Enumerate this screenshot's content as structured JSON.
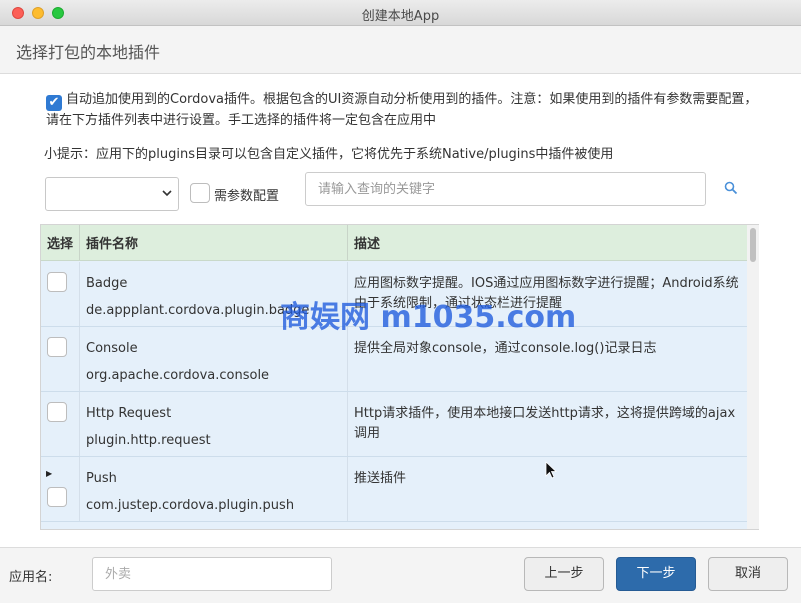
{
  "window": {
    "title": "创建本地App"
  },
  "header": {
    "title": "选择打包的本地插件"
  },
  "notice": {
    "checked": true,
    "text": "自动追加使用到的Cordova插件。根据包含的UI资源自动分析使用到的插件。注意：如果使用到的插件有参数需要配置，请在下方插件列表中进行设置。手工选择的插件将一定包含在应用中"
  },
  "hint": {
    "text": "小提示：应用下的plugins目录可以包含自定义插件，它将优先于系统Native/plugins中插件被使用"
  },
  "filter": {
    "selected": "",
    "param_label": "需参数配置",
    "search_placeholder": "请输入查询的关键字"
  },
  "table": {
    "headers": [
      "选择",
      "插件名称",
      "描述"
    ],
    "rows": [
      {
        "name": "Badge",
        "id": "de.appplant.cordova.plugin.badge",
        "desc": "应用图标数字提醒。IOS通过应用图标数字进行提醒；Android系统由于系统限制，通过状态栏进行提醒",
        "checked": false
      },
      {
        "name": "Console",
        "id": "org.apache.cordova.console",
        "desc": "提供全局对象console，通过console.log()记录日志",
        "checked": false
      },
      {
        "name": "Http Request",
        "id": "plugin.http.request",
        "desc": "Http请求插件，使用本地接口发送http请求，这将提供跨域的ajax调用",
        "checked": false
      },
      {
        "name": "Push",
        "id": "com.justep.cordova.plugin.push",
        "desc": "推送插件",
        "checked": false
      }
    ]
  },
  "footer": {
    "app_label": "应用名:",
    "app_placeholder": "外卖",
    "prev_label": "上一步",
    "next_label": "下一步",
    "cancel_label": "取消"
  },
  "watermark": {
    "text": "商娱网 m1035.com"
  },
  "colors": {
    "accent": "#2f7ad3",
    "primary_button": "#2d6bab",
    "table_header": "#ddeedd",
    "table_row": "#e5f0fa"
  }
}
